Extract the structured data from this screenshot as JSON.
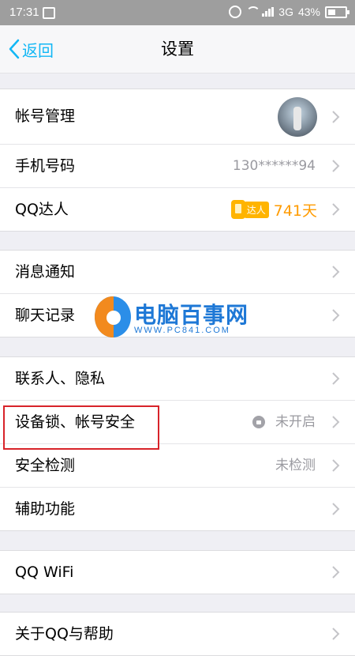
{
  "status_bar": {
    "time": "17:31",
    "network": "3G",
    "battery": "43%"
  },
  "nav": {
    "back_label": "返回",
    "title": "设置"
  },
  "groups": [
    {
      "rows": [
        {
          "label": "帐号管理",
          "type": "avatar"
        },
        {
          "label": "手机号码",
          "value": "130******94"
        },
        {
          "label": "QQ达人",
          "badge": "达人",
          "value": "741天"
        }
      ]
    },
    {
      "rows": [
        {
          "label": "消息通知"
        },
        {
          "label": "聊天记录"
        }
      ]
    },
    {
      "rows": [
        {
          "label": "联系人、隐私"
        },
        {
          "label": "设备锁、帐号安全",
          "value": "未开启",
          "icon": "lock-icon"
        },
        {
          "label": "安全检测",
          "value": "未检测"
        },
        {
          "label": "辅助功能"
        }
      ]
    },
    {
      "rows": [
        {
          "label": "QQ WiFi"
        }
      ]
    },
    {
      "rows": [
        {
          "label": "关于QQ与帮助"
        }
      ]
    }
  ],
  "watermark": {
    "title": "电脑百事网",
    "url": "WWW.PC841.COM"
  },
  "colors": {
    "accent": "#12b7f5",
    "highlight": "#d8232a",
    "talent": "#ff9b00"
  }
}
